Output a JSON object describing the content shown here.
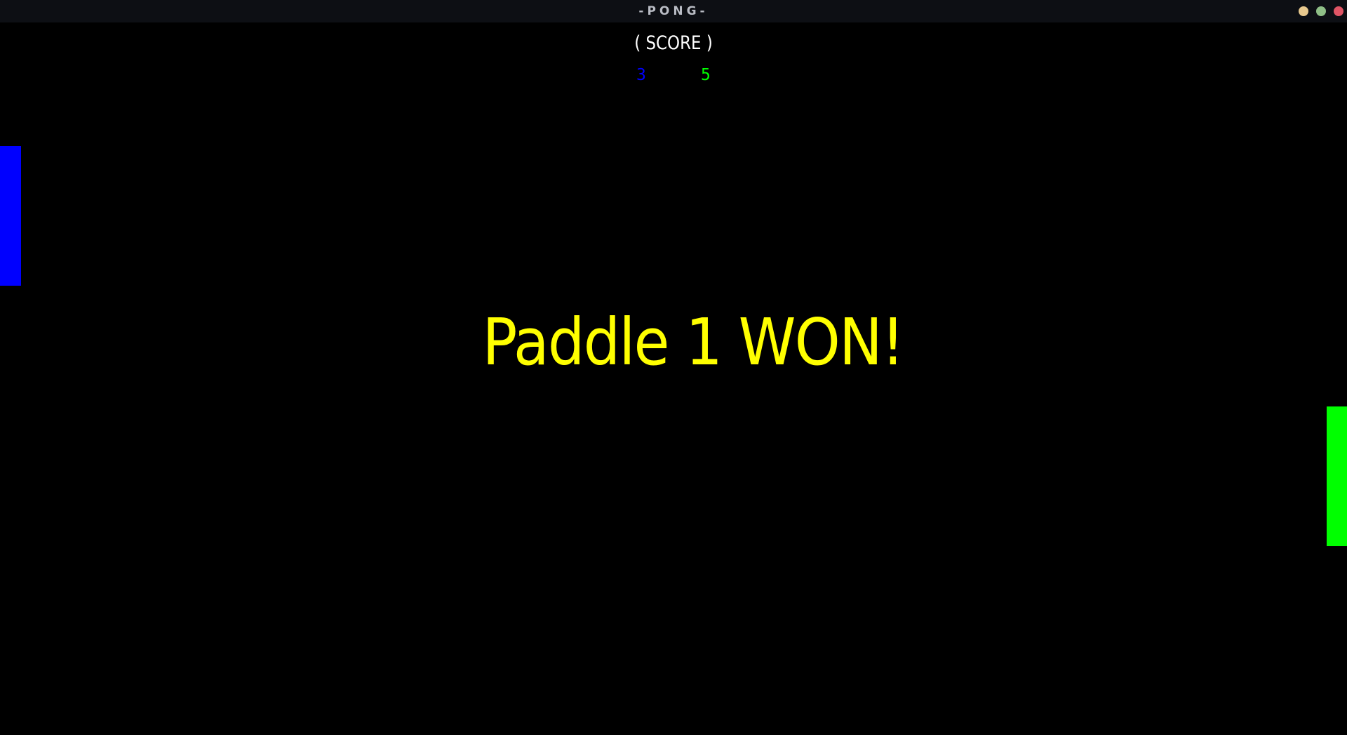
{
  "window": {
    "title": "-PONG-",
    "controls": [
      "minimize-button",
      "maximize-button",
      "close-button"
    ]
  },
  "scoreboard": {
    "label": "( SCORE )",
    "player1_score": "3",
    "player2_score": "5"
  },
  "message": "Paddle 1 WON!",
  "colors": {
    "background": "#000000",
    "titlebar": "#0d0f14",
    "paddle1": "#0000ff",
    "paddle2": "#00ff00",
    "message": "#ffff00",
    "score_label": "#ffffff"
  }
}
